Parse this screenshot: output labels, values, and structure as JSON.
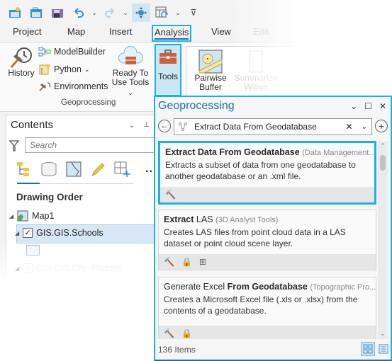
{
  "qat": {
    "items": [
      {
        "name": "new-project",
        "icon": "new-project-icon"
      },
      {
        "name": "open-project",
        "icon": "open-folder-icon"
      },
      {
        "name": "save-project",
        "icon": "save-icon"
      },
      {
        "name": "undo",
        "icon": "undo-icon"
      },
      {
        "name": "redo",
        "icon": "redo-icon"
      },
      {
        "name": "explore",
        "icon": "explore-icon"
      },
      {
        "name": "layout",
        "icon": "layout-icon"
      },
      {
        "name": "customize",
        "icon": "customize-icon"
      }
    ]
  },
  "tabs": [
    {
      "label": "Project"
    },
    {
      "label": "Map"
    },
    {
      "label": "Insert"
    },
    {
      "label": "Analysis",
      "active": true
    },
    {
      "label": "View"
    },
    {
      "label": "Edit"
    }
  ],
  "ribbon": {
    "history": "History",
    "modelbuilder": "ModelBuilder",
    "python": "Python",
    "environments": "Environments",
    "ready_to_use_line1": "Ready To",
    "ready_to_use_line2": "Use Tools",
    "tools": "Tools",
    "group_label": "Geoprocessing",
    "gallery": [
      {
        "line1": "Pairwise",
        "line2": "Buffer"
      },
      {
        "line1": "Summarize",
        "line2": "Within"
      }
    ]
  },
  "contents": {
    "title": "Contents",
    "search_placeholder": "Search",
    "section": "Drawing Order",
    "map": "Map1",
    "layers": [
      {
        "name": "GIS.GIS.Schools",
        "checked": true,
        "selected": true
      },
      {
        "name": "GIS.GIS.City_Parcels",
        "checked": true,
        "selected": false
      }
    ],
    "more": "..."
  },
  "geoprocessing": {
    "title": "Geoprocessing",
    "search_value": "Extract Data From Geodatabase",
    "results": [
      {
        "title_plain": "",
        "title_bold": "Extract Data From Geodatabase",
        "toolbox": "(Data Management...",
        "description": "Extracts a subset of data from one geodatabase to another geodatabase or an .xml file.",
        "badges": [
          "hammer"
        ]
      },
      {
        "title_plain": "",
        "title_bold": "Extract",
        "title_rest": " LAS",
        "toolbox": "(3D Analyst Tools)",
        "description": "Creates LAS files from point cloud data in a LAS dataset or point cloud scene layer.",
        "badges": [
          "hammer",
          "lock",
          "parallel"
        ]
      },
      {
        "title_plain": "Generate Excel ",
        "title_bold": "From Geodatabase",
        "toolbox": "(Topographic Pro...",
        "description": "Creates a Microsoft Excel file (.xls or .xlsx) from the contents of a geodatabase.",
        "badges": [
          "hammer",
          "lock"
        ]
      }
    ],
    "count": "136 Items"
  },
  "colors": {
    "accent": "#1ab1e6",
    "brand": "#1a72b8"
  }
}
